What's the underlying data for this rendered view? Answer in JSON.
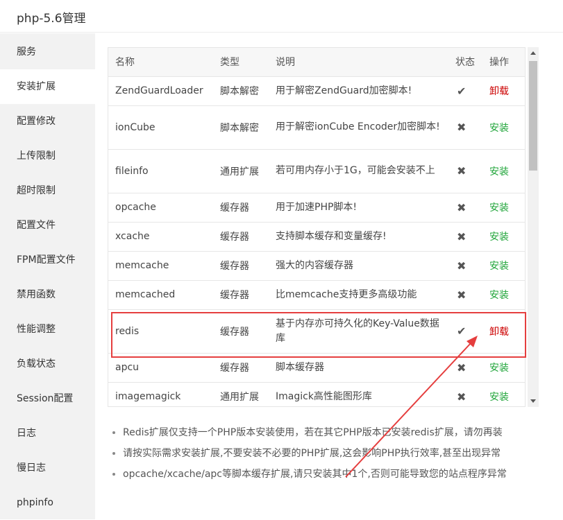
{
  "window": {
    "title": "php-5.6管理"
  },
  "sidebar": {
    "items": [
      {
        "label": "服务",
        "active": false
      },
      {
        "label": "安装扩展",
        "active": true
      },
      {
        "label": "配置修改",
        "active": false
      },
      {
        "label": "上传限制",
        "active": false
      },
      {
        "label": "超时限制",
        "active": false
      },
      {
        "label": "配置文件",
        "active": false
      },
      {
        "label": "FPM配置文件",
        "active": false
      },
      {
        "label": "禁用函数",
        "active": false
      },
      {
        "label": "性能调整",
        "active": false
      },
      {
        "label": "负载状态",
        "active": false
      },
      {
        "label": "Session配置",
        "active": false
      },
      {
        "label": "日志",
        "active": false
      },
      {
        "label": "慢日志",
        "active": false
      },
      {
        "label": "phpinfo",
        "active": false
      }
    ]
  },
  "table": {
    "headers": {
      "name": "名称",
      "type": "类型",
      "desc": "说明",
      "status": "状态",
      "action": "操作"
    },
    "rows": [
      {
        "name": "ZendGuardLoader",
        "type": "脚本解密",
        "desc": "用于解密ZendGuard加密脚本!",
        "status": "installed",
        "action": "卸载"
      },
      {
        "name": "ionCube",
        "type": "脚本解密",
        "desc": "用于解密ionCube Encoder加密脚本!",
        "status": "not-installed",
        "action": "安装"
      },
      {
        "name": "fileinfo",
        "type": "通用扩展",
        "desc": "若可用内存小于1G，可能会安装不上",
        "status": "not-installed",
        "action": "安装"
      },
      {
        "name": "opcache",
        "type": "缓存器",
        "desc": "用于加速PHP脚本!",
        "status": "not-installed",
        "action": "安装"
      },
      {
        "name": "xcache",
        "type": "缓存器",
        "desc": "支持脚本缓存和变量缓存!",
        "status": "not-installed",
        "action": "安装"
      },
      {
        "name": "memcache",
        "type": "缓存器",
        "desc": "强大的内容缓存器",
        "status": "not-installed",
        "action": "安装"
      },
      {
        "name": "memcached",
        "type": "缓存器",
        "desc": "比memcache支持更多高级功能",
        "status": "not-installed",
        "action": "安装"
      },
      {
        "name": "redis",
        "type": "缓存器",
        "desc": "基于内存亦可持久化的Key-Value数据库",
        "status": "installed",
        "action": "卸载"
      },
      {
        "name": "apcu",
        "type": "缓存器",
        "desc": "脚本缓存器",
        "status": "not-installed",
        "action": "安装"
      },
      {
        "name": "imagemagick",
        "type": "通用扩展",
        "desc": "Imagick高性能图形库",
        "status": "not-installed",
        "action": "安装"
      }
    ]
  },
  "notes": [
    "Redis扩展仅支持一个PHP版本安装使用，若在其它PHP版本已安装redis扩展，请勿再装",
    "请按实际需求安装扩展,不要安装不必要的PHP扩展,这会影响PHP执行效率,甚至出现异常",
    "opcache/xcache/apc等脚本缓存扩展,请只安装其中1个,否则可能导致您的站点程序异常"
  ],
  "icons": {
    "installed": "check-icon",
    "not_installed": "cross-icon"
  },
  "colors": {
    "install": "#20a53a",
    "uninstall": "#cc0000",
    "annotation": "#e53e3e"
  }
}
